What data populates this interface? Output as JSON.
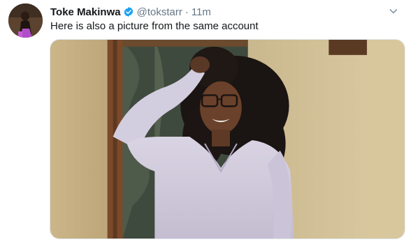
{
  "tweet": {
    "author": {
      "display_name": "Toke Makinwa",
      "handle": "@tokstarr",
      "verified": true,
      "verified_icon": "verified-badge-icon",
      "avatar_icon": "avatar"
    },
    "separator": "·",
    "timestamp": "11m",
    "text": "Here is also a picture from the same account",
    "media": {
      "type": "photo",
      "alt": ""
    },
    "menu_icon": "chevron-down-icon"
  },
  "colors": {
    "text_primary": "#14171a",
    "text_secondary": "#657786",
    "verified_blue": "#1da1f2",
    "border": "#e1e8ed"
  }
}
